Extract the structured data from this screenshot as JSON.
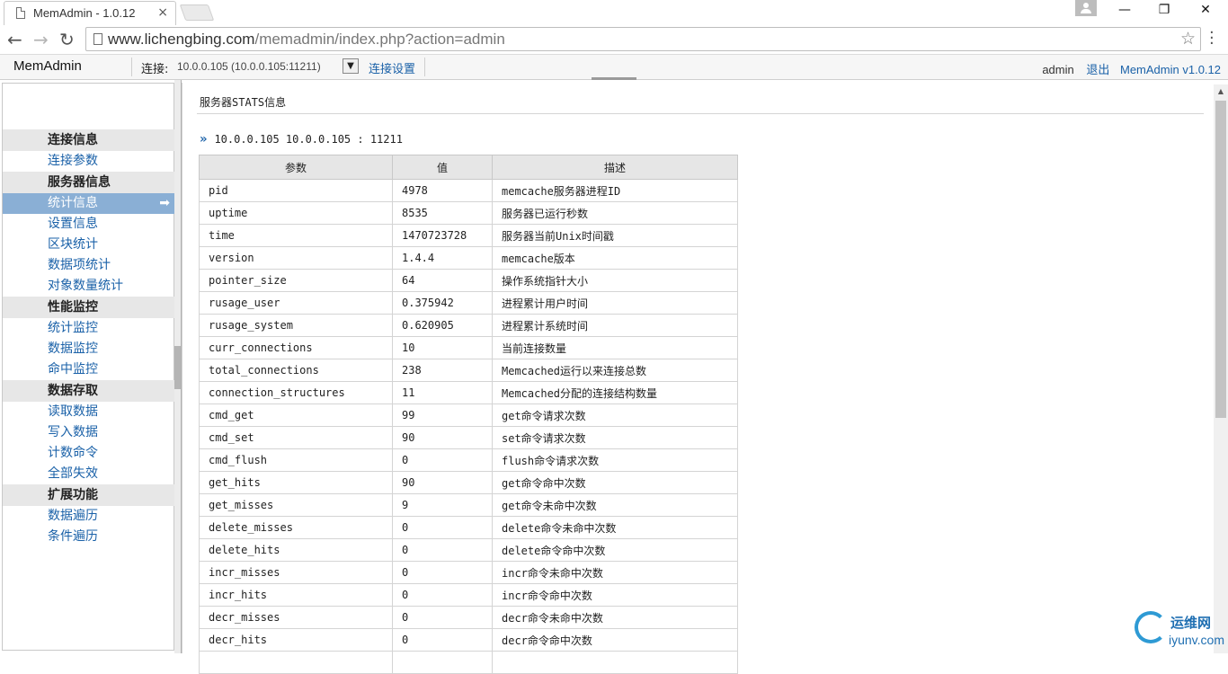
{
  "browser": {
    "tab_title": "MemAdmin - 1.0.12",
    "tab_close": "×",
    "url_host": "www.lichengbing.com",
    "url_path": "/memadmin/index.php?action=admin",
    "window_minimize": "—",
    "window_restore": "❐",
    "window_close": "✕",
    "back": "←",
    "forward": "→",
    "reload": "↻",
    "star": "☆"
  },
  "header": {
    "brand": "MemAdmin",
    "conn_label": "连接:",
    "conn_value": "10.0.0.105 (10.0.0.105:11211)",
    "conn_dropdown": "▼",
    "conn_settings": "连接设置",
    "user": "admin",
    "logout": "退出",
    "version_link": "MemAdmin v1.0.12"
  },
  "sidebar": {
    "sections": [
      {
        "title": "连接信息",
        "items": [
          "连接参数"
        ]
      },
      {
        "title": "服务器信息",
        "items": [
          "统计信息",
          "设置信息",
          "区块统计",
          "数据项统计",
          "对象数量统计"
        ]
      },
      {
        "title": "性能监控",
        "items": [
          "统计监控",
          "数据监控",
          "命中监控"
        ]
      },
      {
        "title": "数据存取",
        "items": [
          "读取数据",
          "写入数据",
          "计数命令",
          "全部失效"
        ]
      },
      {
        "title": "扩展功能",
        "items": [
          "数据遍历",
          "条件遍历"
        ]
      }
    ],
    "active_item": "统计信息",
    "active_arrow": "➡"
  },
  "main": {
    "section_title": "服务器STATS信息",
    "server_arrow": "»",
    "server_line": "10.0.0.105 10.0.0.105 : 11211",
    "table": {
      "headers": [
        "参数",
        "值",
        "描述"
      ],
      "rows": [
        [
          "pid",
          "4978",
          "memcache服务器进程ID"
        ],
        [
          "uptime",
          "8535",
          "服务器已运行秒数"
        ],
        [
          "time",
          "1470723728",
          "服务器当前Unix时间戳"
        ],
        [
          "version",
          "1.4.4",
          "memcache版本"
        ],
        [
          "pointer_size",
          "64",
          "操作系统指针大小"
        ],
        [
          "rusage_user",
          "0.375942",
          "进程累计用户时间"
        ],
        [
          "rusage_system",
          "0.620905",
          "进程累计系统时间"
        ],
        [
          "curr_connections",
          "10",
          "当前连接数量"
        ],
        [
          "total_connections",
          "238",
          "Memcached运行以来连接总数"
        ],
        [
          "connection_structures",
          "11",
          "Memcached分配的连接结构数量"
        ],
        [
          "cmd_get",
          "99",
          "get命令请求次数"
        ],
        [
          "cmd_set",
          "90",
          "set命令请求次数"
        ],
        [
          "cmd_flush",
          "0",
          "flush命令请求次数"
        ],
        [
          "get_hits",
          "90",
          "get命令命中次数"
        ],
        [
          "get_misses",
          "9",
          "get命令未命中次数"
        ],
        [
          "delete_misses",
          "0",
          "delete命令未命中次数"
        ],
        [
          "delete_hits",
          "0",
          "delete命令命中次数"
        ],
        [
          "incr_misses",
          "0",
          "incr命令未命中次数"
        ],
        [
          "incr_hits",
          "0",
          "incr命令命中次数"
        ],
        [
          "decr_misses",
          "0",
          "decr命令未命中次数"
        ],
        [
          "decr_hits",
          "0",
          "decr命令命中次数"
        ],
        [
          "",
          "",
          ""
        ]
      ]
    }
  },
  "watermark": {
    "cn": "运维网",
    "en": "iyunv.com"
  }
}
